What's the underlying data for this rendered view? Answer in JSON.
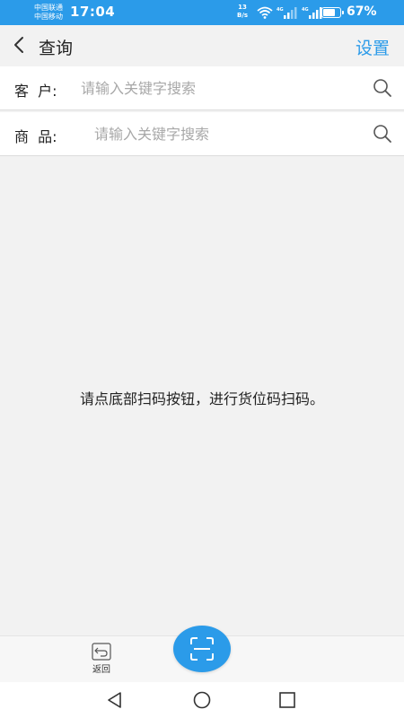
{
  "status_bar": {
    "carrier_1": "中国联通",
    "carrier_2": "中国移动",
    "time": "17:04",
    "net_speed_value": "13",
    "net_speed_unit": "B/s",
    "battery_percent": "67%",
    "battery_level": 0.67
  },
  "header": {
    "title": "查询",
    "settings_label": "设置"
  },
  "search": {
    "customer": {
      "label": "客  户:",
      "value": "",
      "placeholder": "请输入关键字搜索"
    },
    "product": {
      "label": "商  品:",
      "value": "",
      "placeholder": "请输入关键字搜索"
    }
  },
  "main": {
    "hint": "请点底部扫码按钮，进行货位码扫码。"
  },
  "bottom_bar": {
    "return_label": "返回",
    "scan_icon": "scan-icon"
  },
  "colors": {
    "accent": "#2b9be9",
    "background": "#f2f2f2"
  }
}
